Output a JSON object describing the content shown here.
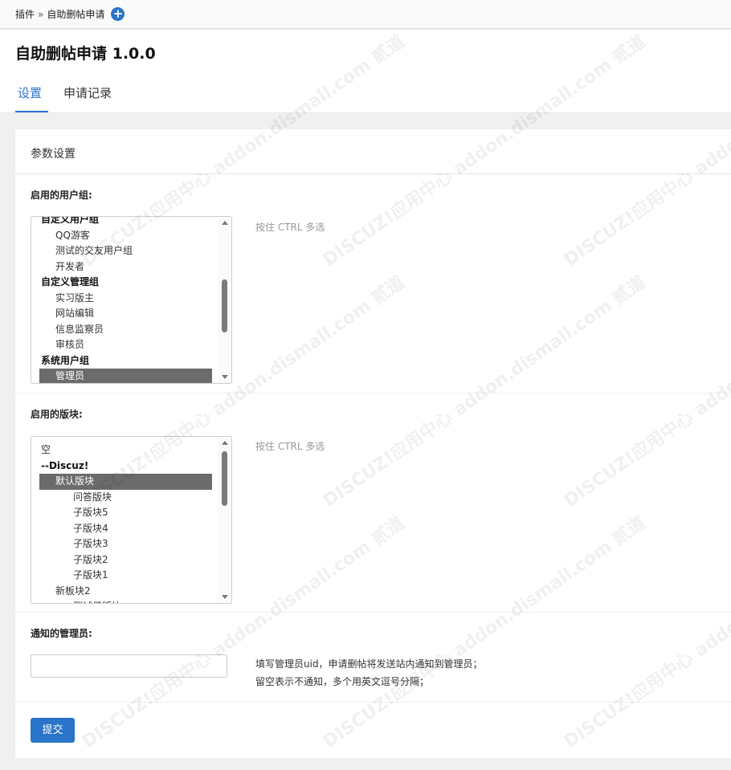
{
  "breadcrumb": {
    "parent": "插件",
    "separator": "»",
    "current": "自助删帖申请"
  },
  "page_title": "自助删帖申请 1.0.0",
  "tabs": [
    {
      "label": "设置",
      "active": true
    },
    {
      "label": "申请记录",
      "active": false
    }
  ],
  "panel": {
    "title": "参数设置"
  },
  "user_groups": {
    "label": "启用的用户组:",
    "hint": "按住 CTRL 多选",
    "options": [
      {
        "label": "自定义用户组",
        "level": 0,
        "group": true
      },
      {
        "label": "QQ游客",
        "level": 1
      },
      {
        "label": "测试的交友用户组",
        "level": 1
      },
      {
        "label": "开发者",
        "level": 1
      },
      {
        "label": "自定义管理组",
        "level": 0,
        "group": true
      },
      {
        "label": "实习版主",
        "level": 1
      },
      {
        "label": "网站编辑",
        "level": 1
      },
      {
        "label": "信息监察员",
        "level": 1
      },
      {
        "label": "审核员",
        "level": 1
      },
      {
        "label": "系统用户组",
        "level": 0,
        "group": true
      },
      {
        "label": "管理员",
        "level": 1,
        "selected": true
      }
    ]
  },
  "forums": {
    "label": "启用的版块:",
    "hint": "按住 CTRL 多选",
    "options": [
      {
        "label": "空",
        "level": 0
      },
      {
        "label": "--Discuz!",
        "level": 0,
        "group": true
      },
      {
        "label": "默认版块",
        "level": 1,
        "selected": true
      },
      {
        "label": "问答版块",
        "level": 2
      },
      {
        "label": "子版块5",
        "level": 2
      },
      {
        "label": "子版块4",
        "level": 2
      },
      {
        "label": "子版块3",
        "level": 2
      },
      {
        "label": "子版块2",
        "level": 2
      },
      {
        "label": "子版块1",
        "level": 2
      },
      {
        "label": "新板块2",
        "level": 1
      },
      {
        "label": "测试子版块",
        "level": 2
      }
    ]
  },
  "notify_admin": {
    "label": "通知的管理员:",
    "value": "",
    "hint_line1": "填写管理员uid，申请删帖将发送站内通知到管理员；",
    "hint_line2": "留空表示不通知，多个用英文逗号分隔；"
  },
  "submit_label": "提交",
  "colors": {
    "accent": "#2a74c9",
    "selected_option": "#6b6b6b"
  },
  "watermark_text": "DISCUZ!应用中心 addon.dismall.com 贰道"
}
